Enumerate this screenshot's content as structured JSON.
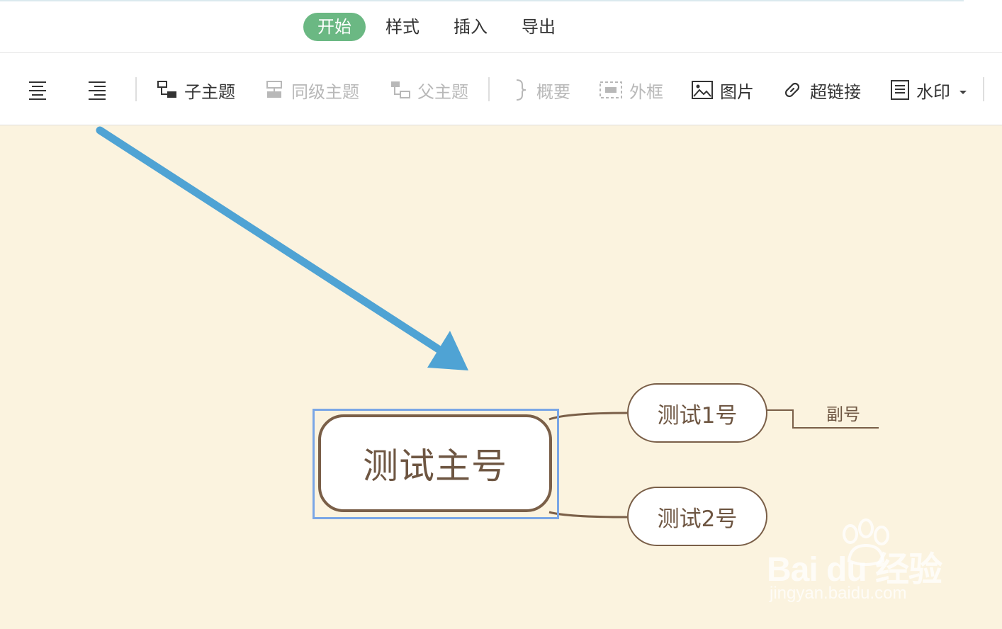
{
  "menu": {
    "tabs": [
      {
        "label": "开始",
        "active": true
      },
      {
        "label": "样式",
        "active": false
      },
      {
        "label": "插入",
        "active": false
      },
      {
        "label": "导出",
        "active": false
      }
    ]
  },
  "toolbar": {
    "child_topic": "子主题",
    "sibling_topic": "同级主题",
    "parent_topic": "父主题",
    "summary": "概要",
    "frame": "外框",
    "image": "图片",
    "hyperlink": "超链接",
    "watermark": "水印"
  },
  "mindmap": {
    "root": "测试主号",
    "children": [
      "测试1号",
      "测试2号"
    ],
    "leaf": "副号"
  },
  "watermark": {
    "logo": "Bai du 经验",
    "url": "jingyan.baidu.com"
  },
  "colors": {
    "accent": "#6bb883",
    "canvas": "#fbf3df",
    "node_border": "#7a5f48",
    "arrow": "#4fa3d4",
    "selection": "#7aa6e6"
  }
}
